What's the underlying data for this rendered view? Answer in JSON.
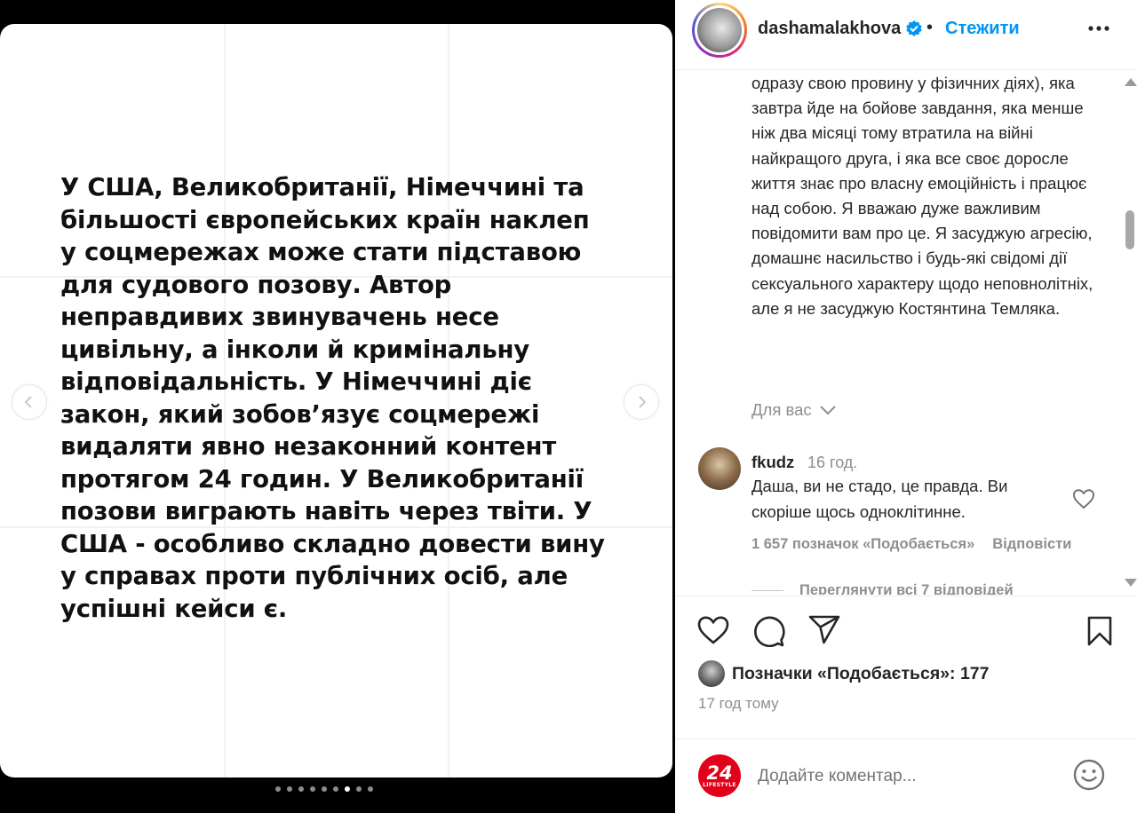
{
  "post": {
    "slide_text": "У США, Великобританії, Німеччині та більшості європейських країн наклеп у соцмережах може стати підставою для судового позову. Автор неправдивих звинувачень несе цивільну, а інколи й кримінальну відповідальність. У Німеччині діє закон, який зобов’язує соцмережі видаляти явно незаконний контент протягом 24 годин. У Великобританії позови виграють навіть через твіти. У США - особливо складно довести вину у справах проти публічних осіб, але успішні кейси є.",
    "slide_count": 9,
    "active_slide": 7
  },
  "header": {
    "username": "dashamalakhova",
    "separator": "•",
    "follow_label": "Стежити"
  },
  "caption": {
    "text": "одразу свою провину у фізичних діях), яка завтра йде на бойове завдання, яка менше ніж два місяці тому втратила на війні найкращого друга, і яка все своє доросле життя знає про власну емоційність і працює над собою. Я вважаю дуже важливим повідомити вам про це. Я засуджую агресію, домашнє насильство і будь-які свідомі дії сексуального характеру щодо неповнолітніх, але я не засуджую Костянтина Темляка."
  },
  "for_you": {
    "label": "Для вас"
  },
  "comment": {
    "username": "fkudz",
    "time": "16 год.",
    "text": "Даша, ви не стадо, це правда. Ви скоріше щось одноклітинне.",
    "likes": "1 657 позначок «Подобається»",
    "reply_label": "Відповісти",
    "view_replies": "Переглянути всі 7 відповідей"
  },
  "actions": {
    "likes_text": "Позначки «Подобається»: 177",
    "time_ago": "17 год тому"
  },
  "comment_box": {
    "placeholder": "Додайте коментар...",
    "logo_number": "24",
    "logo_sub": "LIFESTYLE"
  },
  "colors": {
    "accent": "#0095f6",
    "verified": "#0095f6",
    "logo_red": "#e3001b"
  }
}
